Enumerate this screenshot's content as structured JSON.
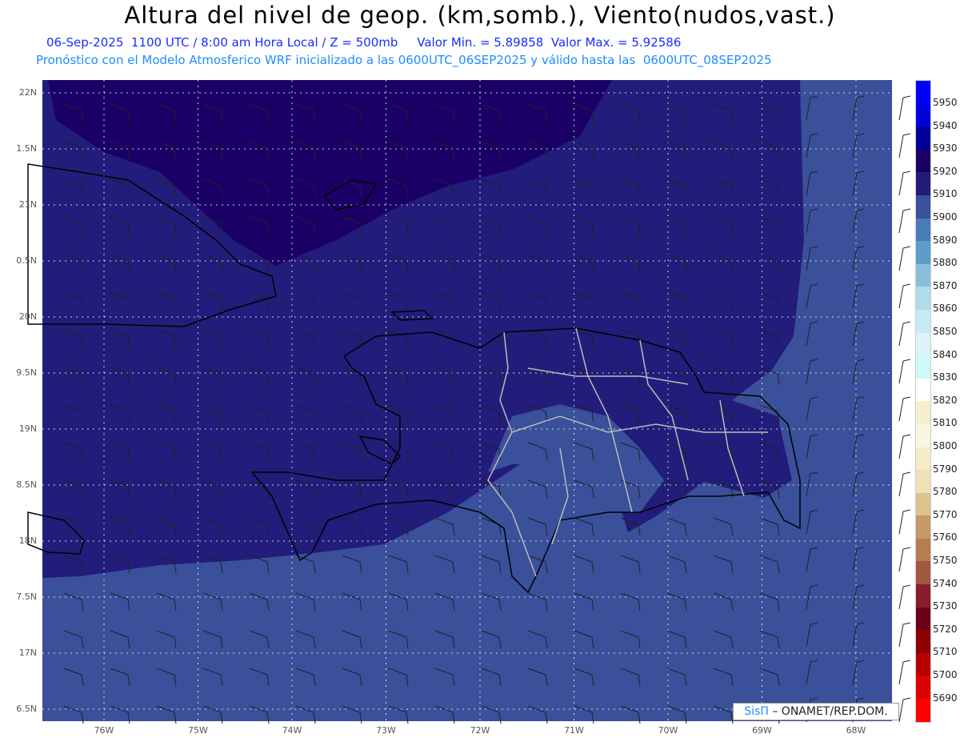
{
  "title": "Altura del nivel de geop. (km,somb.), Viento(nudos,vast.)",
  "subtitle": {
    "date": "06-Sep-2025",
    "time": "1100 UTC / 8:00 am Hora Local / Z = 500mb",
    "min": "Valor Min. = 5.89858",
    "max": "Valor Max. = 5.92586"
  },
  "forecast_line": "Pronóstico con el Modelo Atmosferico WRF inicializado a las 0600UTC_06SEP2025 y válido hasta las  0600UTC_08SEP2025",
  "lat_labels": [
    "22N",
    "1.5N",
    "21N",
    "0.5N",
    "20N",
    "9.5N",
    "19N",
    "8.5N",
    "18N",
    "7.5N",
    "17N",
    "6.5N"
  ],
  "lon_labels": [
    "76W",
    "75W",
    "74W",
    "73W",
    "72W",
    "71W",
    "70W",
    "69W",
    "68W"
  ],
  "colorbar": {
    "labels": [
      "5950",
      "5940",
      "5930",
      "5920",
      "5910",
      "5900",
      "5890",
      "5880",
      "5870",
      "5860",
      "5850",
      "5840",
      "5830",
      "5820",
      "5810",
      "5800",
      "5790",
      "5780",
      "5770",
      "5760",
      "5750",
      "5740",
      "5730",
      "5720",
      "5710",
      "5700",
      "5690"
    ],
    "colors": [
      "#0000ff",
      "#0000dd",
      "#000099",
      "#1a0066",
      "#221c7a",
      "#3a509a",
      "#4a7cb8",
      "#5e9cca",
      "#88c0dc",
      "#b0dce8",
      "#c4ecf2",
      "#dcf4f8",
      "#ccfafa",
      "#ffffff",
      "#f7f0cc",
      "#faf5e4",
      "#f5ecc8",
      "#efe0b6",
      "#dcc28e",
      "#c8986a",
      "#b87c52",
      "#a0583e",
      "#881c28",
      "#6c0018",
      "#8f0000",
      "#b80000",
      "#dd0000",
      "#ff0000"
    ]
  },
  "credit": {
    "brand": "SisΠ",
    "text": " – ONAMET/REP.DOM."
  }
}
